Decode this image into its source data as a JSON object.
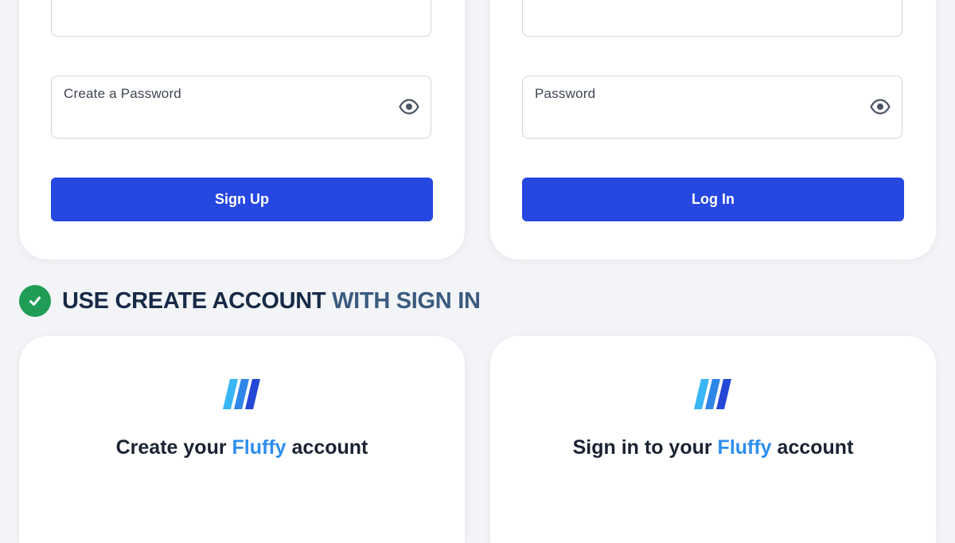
{
  "signup_form": {
    "password_label": "Create a Password",
    "submit_label": "Sign Up"
  },
  "login_form": {
    "password_label": "Password",
    "submit_label": "Log In"
  },
  "section_heading": {
    "icon": "check-circle-icon",
    "part_1": "USE ",
    "part_2": "CREATE ACCOUNT",
    "part_3": " WITH ",
    "part_4": "SIGN IN"
  },
  "create_card": {
    "title_before": "Create your ",
    "brand": "Fluffy",
    "title_after": " account"
  },
  "signin_card": {
    "title_before": "Sign in to your ",
    "brand": "Fluffy",
    "title_after": " account"
  },
  "colors": {
    "primary_button": "#2647e0",
    "success_check": "#1f9d57",
    "brand_text": "#2f8df0",
    "heading_dark": "#172a46",
    "heading_mid": "#3b5b7f"
  },
  "icons": {
    "password_toggle": "eye-icon",
    "logo": "fluffy-logo-icon"
  }
}
